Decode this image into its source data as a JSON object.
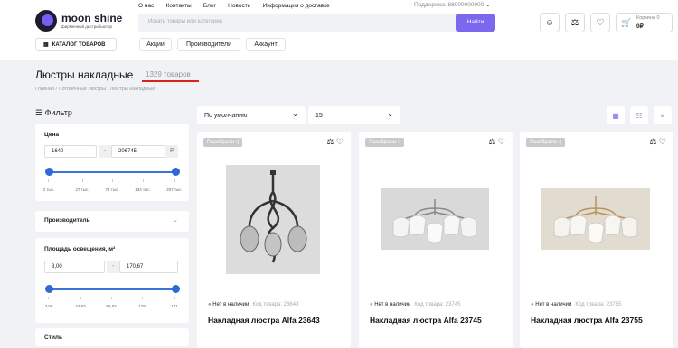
{
  "brand": {
    "name": "moon shine",
    "tagline": "фирменный дистрибьютор"
  },
  "topnav": [
    "О нас",
    "Контакты",
    "Блог",
    "Новости",
    "Информация о доставке"
  ],
  "support": "Поддержка: 88000000000",
  "search": {
    "placeholder": "Искать товары или категории",
    "button": "Найти"
  },
  "cart": {
    "label": "Корзина 0",
    "total": "0₽"
  },
  "catalog_label": "КАТАЛОГ ТОВАРОВ",
  "subnav": [
    "Акции",
    "Производители",
    "Аккаунт"
  ],
  "page": {
    "title": "Люстры накладные",
    "count": "1329 товаров",
    "breadcrumb": [
      "Главная",
      "Потолочные люстры",
      "Люстры накладные"
    ]
  },
  "filter": {
    "title": "Фильтр",
    "price": {
      "label": "Цена",
      "min": "1640",
      "max": "206745",
      "currency": "₽",
      "ticks": [
        "2 тыс.",
        "27 тыс.",
        "74 тыс.",
        "134 тыс.",
        "207 тыс."
      ]
    },
    "manufacturer": "Производитель",
    "area": {
      "label": "Площадь освещения, м²",
      "min": "3,00",
      "max": "170,67",
      "ticks": [
        "3,00",
        "44,93",
        "86,83",
        "129",
        "171"
      ]
    },
    "style": "Стиль"
  },
  "sort": {
    "selected": "По умолчанию",
    "per_page": "15"
  },
  "products": [
    {
      "badge": "Разобрали :(",
      "stock": "Нет в наличии",
      "code": "Код товара: 23643",
      "title": "Накладная люстра Alfa 23643"
    },
    {
      "badge": "Разобрали :(",
      "stock": "Нет в наличии",
      "code": "Код товара: 23745",
      "title": "Накладная люстра Alfa 23745"
    },
    {
      "badge": "Разобрали :(",
      "stock": "Нет в наличии",
      "code": "Код товара: 23755",
      "title": "Накладная люстра Alfa 23755"
    }
  ],
  "colors": {
    "accent": "#7b68ee",
    "slider": "#2f69d6",
    "underline": "#e02020"
  }
}
